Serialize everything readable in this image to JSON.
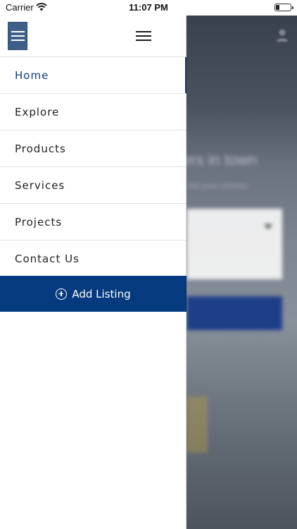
{
  "status_bar": {
    "carrier": "Carrier",
    "time": "11:07 PM",
    "battery_level": 0.2
  },
  "drawer": {
    "icons": {
      "toggle": "hamburger-icon",
      "close": "hamburger-icon"
    },
    "menu": [
      {
        "label": "Home",
        "active": true
      },
      {
        "label": "Explore",
        "active": false
      },
      {
        "label": "Products",
        "active": false
      },
      {
        "label": "Services",
        "active": false
      },
      {
        "label": "Projects",
        "active": false
      },
      {
        "label": "Contact Us",
        "active": false
      }
    ],
    "add_listing": {
      "label": "Add Listing",
      "icon": "plus-circle-icon"
    }
  },
  "background": {
    "heading": "ers in town",
    "subheading": "ind your chosen",
    "user_icon": "user-icon"
  },
  "colors": {
    "primary": "#053a7f",
    "active_text": "#163c7a",
    "toggle_bg": "#3e5f87"
  }
}
